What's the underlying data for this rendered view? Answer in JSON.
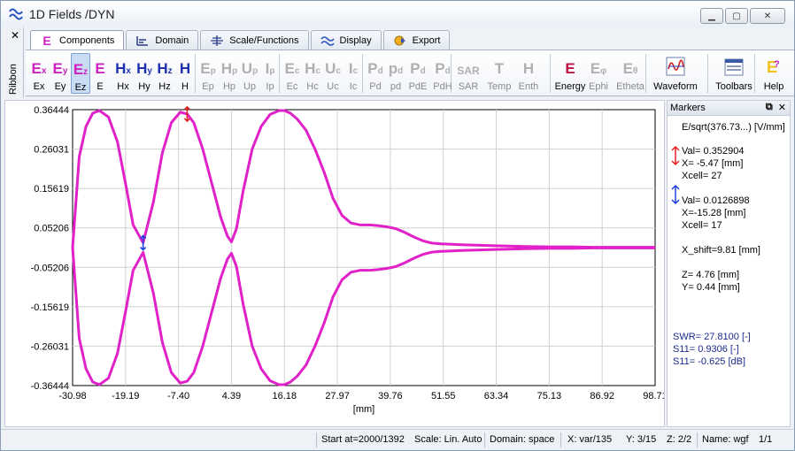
{
  "window": {
    "title": "1D Fields /DYN",
    "controls": [
      "minimize",
      "maximize",
      "close"
    ]
  },
  "ribbon": {
    "label": "Ribbon",
    "close_glyph": "✕"
  },
  "tabs": [
    {
      "label": "Components",
      "icon": "E",
      "active": true
    },
    {
      "label": "Domain",
      "icon": "domain-icon"
    },
    {
      "label": "Scale/Functions",
      "icon": "scale-icon"
    },
    {
      "label": "Display",
      "icon": "display-icon"
    },
    {
      "label": "Export",
      "icon": "export-icon"
    }
  ],
  "toolbar": {
    "buttons": [
      {
        "label": "Ex",
        "glyph": "E",
        "sub": "x",
        "color": "#d020c0"
      },
      {
        "label": "Ey",
        "glyph": "E",
        "sub": "y",
        "color": "#d020c0"
      },
      {
        "label": "Ez",
        "glyph": "E",
        "sub": "z",
        "color": "#d020c0",
        "active": true
      },
      {
        "label": "E",
        "glyph": "E",
        "sub": "",
        "color": "#d020c0"
      },
      {
        "label": "Hx",
        "glyph": "H",
        "sub": "x",
        "color": "#2030b0"
      },
      {
        "label": "Hy",
        "glyph": "H",
        "sub": "y",
        "color": "#2030b0"
      },
      {
        "label": "Hz",
        "glyph": "H",
        "sub": "z",
        "color": "#2030b0"
      },
      {
        "label": "H",
        "glyph": "H",
        "sub": "",
        "color": "#2030b0"
      },
      {
        "label": "Ep",
        "glyph": "E",
        "sub": "p",
        "disabled": true
      },
      {
        "label": "Hp",
        "glyph": "H",
        "sub": "p",
        "disabled": true
      },
      {
        "label": "Up",
        "glyph": "U",
        "sub": "p",
        "disabled": true
      },
      {
        "label": "Ip",
        "glyph": "I",
        "sub": "p",
        "disabled": true
      },
      {
        "label": "Ec",
        "glyph": "E",
        "sub": "c",
        "disabled": true
      },
      {
        "label": "Hc",
        "glyph": "H",
        "sub": "c",
        "disabled": true
      },
      {
        "label": "Uc",
        "glyph": "U",
        "sub": "c",
        "disabled": true
      },
      {
        "label": "Ic",
        "glyph": "I",
        "sub": "c",
        "disabled": true
      },
      {
        "label": "Pd",
        "glyph": "P",
        "sub": "d",
        "disabled": true
      },
      {
        "label": "pd",
        "glyph": "p",
        "sub": "d",
        "disabled": true
      },
      {
        "label": "PdE",
        "glyph": "P",
        "sub": "d",
        "disabled": true
      },
      {
        "label": "PdH",
        "glyph": "P",
        "sub": "d",
        "disabled": true
      },
      {
        "label": "SAR",
        "glyph": "SAR",
        "sub": "",
        "disabled": true
      },
      {
        "label": "Temp",
        "glyph": "T",
        "sub": "",
        "disabled": true
      },
      {
        "label": "Enth",
        "glyph": "H",
        "sub": "",
        "disabled": true
      },
      {
        "label": "Energy",
        "glyph": "E",
        "sub": "",
        "color": "#c01040"
      },
      {
        "label": "Ephi",
        "glyph": "E",
        "sub": "φ",
        "disabled": true
      },
      {
        "label": "Etheta",
        "glyph": "E",
        "sub": "θ",
        "disabled": true
      },
      {
        "label": "Waveform",
        "glyph": "waveform-icon",
        "sub": ""
      },
      {
        "label": "Toolbars",
        "glyph": "toolbars-icon",
        "sub": ""
      },
      {
        "label": "Help",
        "glyph": "help-icon",
        "sub": ""
      }
    ]
  },
  "chart_data": {
    "type": "line",
    "xlabel": "[mm]",
    "x_ticks": [
      "-30.98",
      "-19.19",
      "-7.40",
      "4.39",
      "16.18",
      "27.97",
      "39.76",
      "51.55",
      "63.34",
      "75.13",
      "86.92",
      "98.71"
    ],
    "y_ticks": [
      "0.36444",
      "0.26031",
      "0.15619",
      "0.05206",
      "-0.05206",
      "-0.15619",
      "-0.26031",
      "-0.36444"
    ],
    "xlim": [
      -30.98,
      98.71
    ],
    "ylim": [
      -0.36444,
      0.36444
    ],
    "grid": true,
    "line_color": "#e020c8",
    "series": [
      {
        "x": [
          -30.98,
          -29.5,
          -28,
          -26.5,
          -25,
          -23,
          -21,
          -19.2,
          -17.5,
          -15.28,
          -13,
          -11,
          -9,
          -7,
          -5.47,
          -4,
          -2,
          0,
          2,
          3.5,
          4.39,
          5.5,
          7,
          9,
          11,
          13,
          15,
          16.18,
          17.5,
          19,
          21,
          23,
          25,
          27,
          29,
          31,
          33,
          35,
          37,
          39,
          41,
          43,
          45,
          47,
          49,
          51,
          53,
          55,
          57,
          60,
          63,
          66,
          70,
          75,
          80,
          85,
          90,
          95,
          98.71
        ],
        "y": [
          0.0,
          0.24,
          0.32,
          0.355,
          0.362,
          0.345,
          0.28,
          0.17,
          0.06,
          0.0127,
          0.12,
          0.25,
          0.33,
          0.358,
          0.3529,
          0.33,
          0.26,
          0.17,
          0.08,
          0.03,
          0.015,
          0.05,
          0.15,
          0.26,
          0.32,
          0.352,
          0.362,
          0.362,
          0.355,
          0.34,
          0.31,
          0.26,
          0.2,
          0.13,
          0.085,
          0.065,
          0.06,
          0.06,
          0.058,
          0.055,
          0.05,
          0.04,
          0.028,
          0.018,
          0.012,
          0.01,
          0.009,
          0.008,
          0.007,
          0.006,
          0.005,
          0.004,
          0.003,
          0.002,
          0.002,
          0.001,
          0.001,
          0.001,
          0.001
        ]
      }
    ],
    "markers": [
      {
        "x": -5.47,
        "y": 0.352904,
        "color": "#e02020"
      },
      {
        "x": -15.28,
        "y": 0.0126898,
        "color": "#2040e0"
      }
    ]
  },
  "markers_panel": {
    "title": "Markers",
    "unit_label": "E/sqrt(376.73...) [V/mm]",
    "marker1": {
      "val": "Val= 0.352904",
      "x": "X= -5.47 [mm]",
      "xcell": "Xcell= 27",
      "color": "#e02020"
    },
    "marker2": {
      "val": "Val= 0.0126898",
      "x": "X=-15.28 [mm]",
      "xcell": "Xcell= 17",
      "color": "#2040e0"
    },
    "x_shift": "X_shift=9.81 [mm]",
    "z": "Z=  4.76 [mm]",
    "y": "Y=  0.44 [mm]",
    "swr": "SWR= 27.8100 [-]",
    "s11_lin": "S11=   0.9306 [-]",
    "s11_db": "S11=  -0.625 [dB]"
  },
  "statusbar": {
    "start": "Start at=2000/1392",
    "scale": "Scale: Lin. Auto",
    "domain": "Domain: space",
    "x": "X: var/135",
    "y": "Y: 3/15",
    "z": "Z: 2/2",
    "name": "Name:  wgf",
    "page": "1/1"
  }
}
